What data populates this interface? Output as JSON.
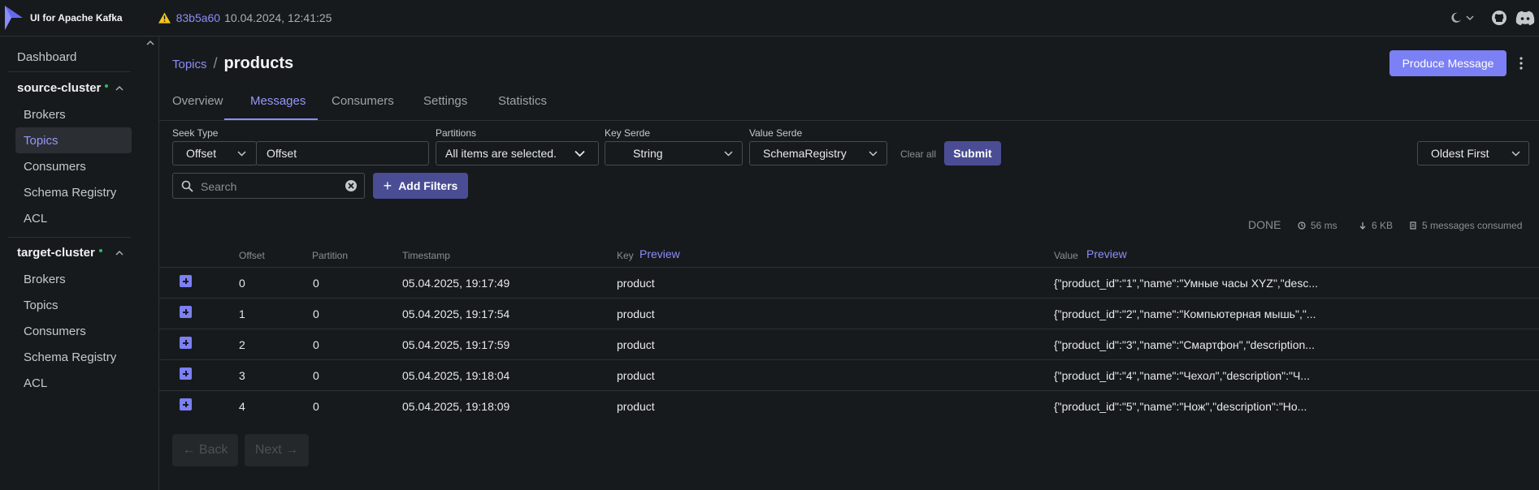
{
  "app": {
    "name": "UI for Apache Kafka"
  },
  "version": {
    "commit": "83b5a60",
    "date": "10.04.2024, 12:41:25"
  },
  "sidebar": {
    "dashboard": "Dashboard",
    "clusters": [
      {
        "name": "source-cluster",
        "items": [
          "Brokers",
          "Topics",
          "Consumers",
          "Schema Registry",
          "ACL"
        ],
        "active": "Topics"
      },
      {
        "name": "target-cluster",
        "items": [
          "Brokers",
          "Topics",
          "Consumers",
          "Schema Registry",
          "ACL"
        ]
      }
    ]
  },
  "breadcrumb": {
    "parent": "Topics",
    "separator": "/",
    "current": "products"
  },
  "produce_button": "Produce Message",
  "tabs": [
    "Overview",
    "Messages",
    "Consumers",
    "Settings",
    "Statistics"
  ],
  "active_tab": "Messages",
  "filters": {
    "seek_type": {
      "label": "Seek Type",
      "value": "Offset",
      "input_placeholder": "Offset"
    },
    "partitions": {
      "label": "Partitions",
      "value": "All items are selected."
    },
    "key_serde": {
      "label": "Key Serde",
      "value": "String"
    },
    "value_serde": {
      "label": "Value Serde",
      "value": "SchemaRegistry"
    },
    "clear_all": "Clear all",
    "submit": "Submit",
    "sort": "Oldest First",
    "search_placeholder": "Search",
    "add_filters": "Add Filters"
  },
  "status": {
    "state": "DONE",
    "elapsed": "56 ms",
    "size": "6 KB",
    "consumed": "5 messages consumed"
  },
  "table": {
    "columns": {
      "offset": "Offset",
      "partition": "Partition",
      "timestamp": "Timestamp",
      "key": "Key",
      "value": "Value",
      "preview": "Preview"
    },
    "rows": [
      {
        "offset": "0",
        "partition": "0",
        "timestamp": "05.04.2025, 19:17:49",
        "key": "product",
        "value": "{\"product_id\":\"1\",\"name\":\"Умные часы XYZ\",\"desc..."
      },
      {
        "offset": "1",
        "partition": "0",
        "timestamp": "05.04.2025, 19:17:54",
        "key": "product",
        "value": "{\"product_id\":\"2\",\"name\":\"Компьютерная мышь\",\"..."
      },
      {
        "offset": "2",
        "partition": "0",
        "timestamp": "05.04.2025, 19:17:59",
        "key": "product",
        "value": "{\"product_id\":\"3\",\"name\":\"Смартфон\",\"description..."
      },
      {
        "offset": "3",
        "partition": "0",
        "timestamp": "05.04.2025, 19:18:04",
        "key": "product",
        "value": "{\"product_id\":\"4\",\"name\":\"Чехол\",\"description\":\"Ч..."
      },
      {
        "offset": "4",
        "partition": "0",
        "timestamp": "05.04.2025, 19:18:09",
        "key": "product",
        "value": "{\"product_id\":\"5\",\"name\":\"Нож\",\"description\":\"Но..."
      }
    ]
  },
  "pagination": {
    "back": "← Back",
    "next": "Next →"
  },
  "colors": {
    "accent": "#7b80f4",
    "background": "#171a1c",
    "link": "#8b8ef8",
    "online": "#23c35a",
    "warning": "#f5c518"
  }
}
